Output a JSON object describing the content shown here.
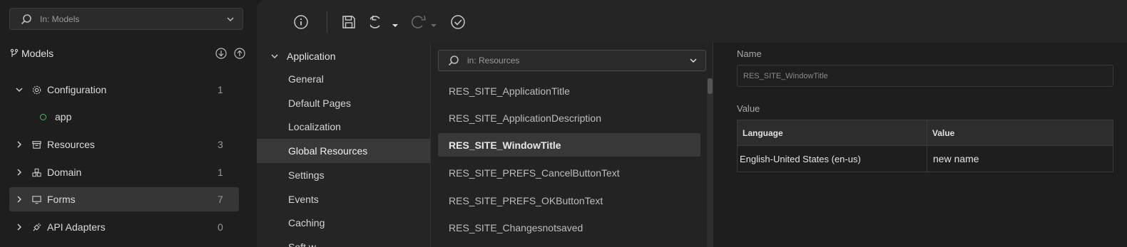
{
  "sidebar": {
    "search_placeholder": "In: Models",
    "models_title": "Models",
    "tree": [
      {
        "label": "Configuration",
        "count": "1",
        "icon": "gear-icon"
      },
      {
        "label": "Resources",
        "count": "3",
        "icon": "archive-icon"
      },
      {
        "label": "Domain",
        "count": "1",
        "icon": "cubes-icon"
      },
      {
        "label": "Forms",
        "count": "7",
        "icon": "monitor-icon"
      },
      {
        "label": "API Adapters",
        "count": "0",
        "icon": "plug-icon"
      }
    ],
    "config_child": "app"
  },
  "nav": {
    "section": "Application",
    "items": [
      "General",
      "Default Pages",
      "Localization",
      "Global Resources",
      "Settings",
      "Events",
      "Caching",
      "Soft w..."
    ]
  },
  "resources": {
    "search_placeholder": "in: Resources",
    "items": [
      "RES_SITE_ApplicationTitle",
      "RES_SITE_ApplicationDescription",
      "RES_SITE_WindowTitle",
      "RES_SITE_PREFS_CancelButtonText",
      "RES_SITE_PREFS_OKButtonText",
      "RES_SITE_Changesnotsaved"
    ]
  },
  "detail": {
    "name_label": "Name",
    "name_value": "RES_SITE_WindowTitle",
    "value_label": "Value",
    "col_language": "Language",
    "col_value": "Value",
    "row_language": "English-United States (en-us)",
    "row_value": "new name"
  },
  "colors": {
    "accent_green": "#4bbf5a",
    "selection": "#383838"
  }
}
